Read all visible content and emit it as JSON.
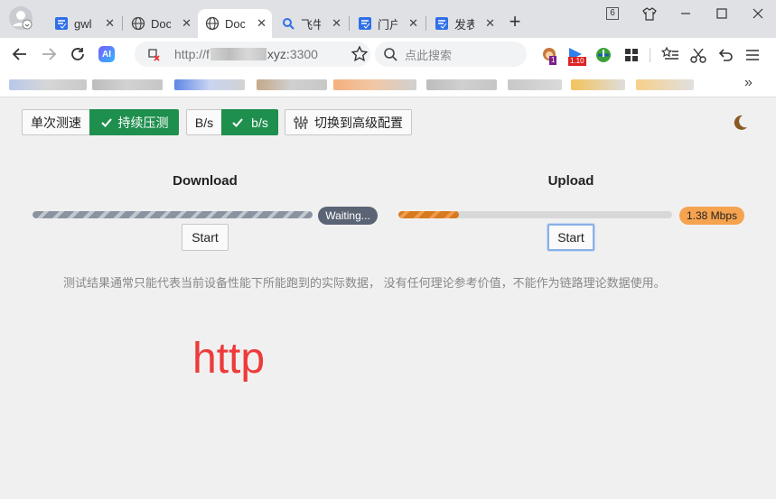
{
  "browser": {
    "tabs": [
      {
        "title": "gwl",
        "icon": "form-icon"
      },
      {
        "title": "Doc",
        "icon": "globe-icon"
      },
      {
        "title": "Doc",
        "icon": "globe-icon",
        "active": true
      },
      {
        "title": "飞牛",
        "icon": "search-icon"
      },
      {
        "title": "门户",
        "icon": "form-icon"
      },
      {
        "title": "发表",
        "icon": "form-icon"
      }
    ],
    "close_glyph": "✕",
    "new_tab_glyph": "+",
    "tab_count": "6",
    "address": {
      "scheme": "http://f",
      "host_tail": "xyz:",
      "port": "3300"
    },
    "search_placeholder": "点此搜索",
    "ext_badges": [
      "1",
      "1.10"
    ],
    "ai_label": "AI"
  },
  "toolbar": {
    "single_test": "单次测速",
    "continuous_test": "持续压测",
    "unit_bytes": "B/s",
    "unit_bits": "b/s",
    "advanced": "切换到高级配置"
  },
  "download": {
    "title": "Download",
    "status": "Waiting...",
    "start": "Start",
    "progress": 1.0
  },
  "upload": {
    "title": "Upload",
    "status": "1.38 Mbps",
    "start": "Start",
    "progress": 0.22
  },
  "note": "测试结果通常只能代表当前设备性能下所能跑到的实际数据， 没有任何理论参考价值，不能作为链路理论数据使用。",
  "big_text": "http",
  "colors": {
    "green": "#1f8f4e",
    "upload_badge": "#f5a34f",
    "download_badge": "#5b6475",
    "big_text": "#ee3a3a"
  }
}
